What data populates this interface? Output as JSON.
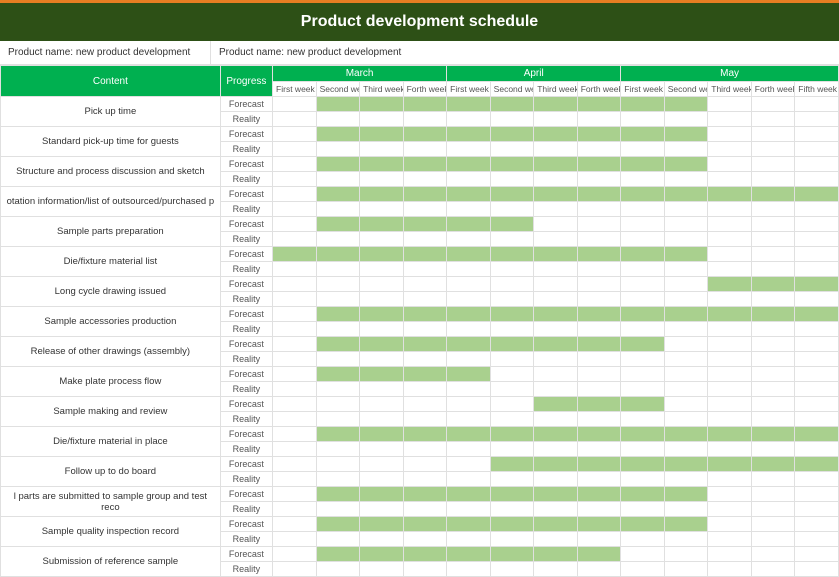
{
  "title": "Product development schedule",
  "product_label_left": "Product name: new product development",
  "product_label_right": "Product name: new product development",
  "headers": {
    "content": "Content",
    "progress": "Progress",
    "months": [
      "March",
      "April",
      "May"
    ],
    "weeks_march": [
      "First week",
      "Second week",
      "Third week",
      "Forth week"
    ],
    "weeks_april": [
      "First week",
      "Second week",
      "Third week",
      "Forth week"
    ],
    "weeks_may": [
      "First week",
      "Second week",
      "Third week",
      "Forth week",
      "Fifth week"
    ]
  },
  "row_types": {
    "forecast": "Forecast",
    "reality": "Reality"
  },
  "tasks": [
    {
      "name": "Pick up time",
      "forecast": [
        0,
        1,
        1,
        1,
        1,
        1,
        1,
        1,
        1,
        1,
        0,
        0,
        0,
        0
      ]
    },
    {
      "name": "Standard pick-up time for guests",
      "forecast": [
        0,
        1,
        1,
        1,
        1,
        1,
        1,
        1,
        1,
        1,
        0,
        0,
        0,
        0
      ]
    },
    {
      "name": "Structure and process discussion and sketch",
      "forecast": [
        0,
        1,
        1,
        1,
        1,
        1,
        1,
        1,
        1,
        1,
        0,
        0,
        0,
        0
      ]
    },
    {
      "name": "otation information/list of outsourced/purchased p",
      "forecast": [
        0,
        1,
        1,
        1,
        1,
        1,
        1,
        1,
        1,
        1,
        1,
        1,
        1,
        0
      ]
    },
    {
      "name": "Sample parts preparation",
      "forecast": [
        0,
        1,
        1,
        1,
        1,
        1,
        0,
        0,
        0,
        0,
        0,
        0,
        0,
        0
      ]
    },
    {
      "name": "Die/fixture material list",
      "forecast": [
        1,
        1,
        1,
        1,
        1,
        1,
        1,
        1,
        1,
        1,
        0,
        0,
        0,
        0
      ]
    },
    {
      "name": "Long cycle drawing issued",
      "forecast": [
        0,
        0,
        0,
        0,
        0,
        0,
        0,
        0,
        0,
        0,
        1,
        1,
        1,
        0
      ]
    },
    {
      "name": "Sample accessories production",
      "forecast": [
        0,
        1,
        1,
        1,
        1,
        1,
        1,
        1,
        1,
        1,
        1,
        1,
        1,
        1
      ]
    },
    {
      "name": "Release of other drawings (assembly)",
      "forecast": [
        0,
        1,
        1,
        1,
        1,
        1,
        1,
        1,
        1,
        0,
        0,
        0,
        0,
        0
      ]
    },
    {
      "name": "Make plate process flow",
      "forecast": [
        0,
        1,
        1,
        1,
        1,
        0,
        0,
        0,
        0,
        0,
        0,
        0,
        0,
        0
      ]
    },
    {
      "name": "Sample making and review",
      "forecast": [
        0,
        0,
        0,
        0,
        0,
        0,
        1,
        1,
        1,
        0,
        0,
        0,
        0,
        0
      ]
    },
    {
      "name": "Die/fixture material in place",
      "forecast": [
        0,
        1,
        1,
        1,
        1,
        1,
        1,
        1,
        1,
        1,
        1,
        1,
        1,
        0
      ]
    },
    {
      "name": "Follow up to do board",
      "forecast": [
        0,
        0,
        0,
        0,
        0,
        1,
        1,
        1,
        1,
        1,
        1,
        1,
        1,
        1
      ]
    },
    {
      "name": "l parts are submitted to sample group and test reco",
      "forecast": [
        0,
        1,
        1,
        1,
        1,
        1,
        1,
        1,
        1,
        1,
        0,
        0,
        0,
        0
      ]
    },
    {
      "name": "Sample quality inspection record",
      "forecast": [
        0,
        1,
        1,
        1,
        1,
        1,
        1,
        1,
        1,
        1,
        0,
        0,
        0,
        0
      ]
    },
    {
      "name": "Submission of reference sample",
      "forecast": [
        0,
        1,
        1,
        1,
        1,
        1,
        1,
        1,
        0,
        0,
        0,
        0,
        0,
        0
      ]
    }
  ]
}
